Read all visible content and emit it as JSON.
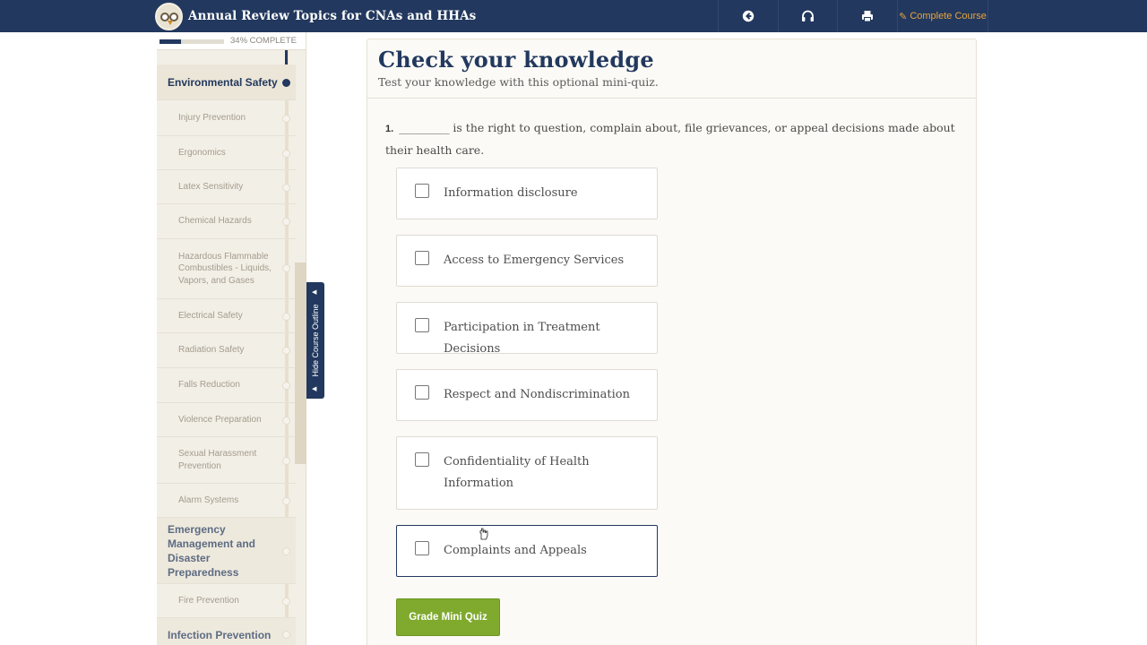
{
  "header": {
    "title": "Annual Review Topics for CNAs and HHAs",
    "complete_label": "Complete Course",
    "icons": [
      "back-arrow-icon",
      "headphones-icon",
      "print-icon",
      "pencil-icon"
    ]
  },
  "sidebar": {
    "progress_label": "34% COMPLETE",
    "progress_value": 0.34,
    "items": [
      {
        "label": "Environmental Safety",
        "type": "section"
      },
      {
        "label": "Injury Prevention",
        "type": "sub"
      },
      {
        "label": "Ergonomics",
        "type": "sub"
      },
      {
        "label": "Latex Sensitivity",
        "type": "sub"
      },
      {
        "label": "Chemical Hazards",
        "type": "sub"
      },
      {
        "label": "Hazardous Flammable Combustibles - Liquids, Vapors, and Gases",
        "type": "sub"
      },
      {
        "label": "Electrical Safety",
        "type": "sub"
      },
      {
        "label": "Radiation Safety",
        "type": "sub"
      },
      {
        "label": "Falls Reduction",
        "type": "sub"
      },
      {
        "label": "Violence Preparation",
        "type": "sub"
      },
      {
        "label": "Sexual Harassment Prevention",
        "type": "sub"
      },
      {
        "label": "Alarm Systems",
        "type": "sub"
      },
      {
        "label": "Emergency Management and Disaster Preparedness",
        "type": "section"
      },
      {
        "label": "Fire Prevention",
        "type": "sub"
      },
      {
        "label": "Infection Prevention",
        "type": "section"
      }
    ],
    "hide_outline_label": "Hide Course Outline"
  },
  "main": {
    "title": "Check your knowledge",
    "subtitle": "Test your knowledge with this optional mini-quiz.",
    "question": {
      "number": "1.",
      "text": "_________ is the right to question, complain about, file grievances, or appeal decisions made about their health care."
    },
    "options": [
      "Information disclosure",
      "Access to Emergency Services",
      "Participation in Treatment Decisions",
      "Respect and Nondiscrimination",
      "Confidentiality of Health Information",
      "Complaints and Appeals"
    ],
    "grade_button": "Grade Mini Quiz"
  },
  "colors": {
    "navy": "#22385e",
    "accent_orange": "#e7a53b",
    "button_green": "#7faa2e"
  }
}
